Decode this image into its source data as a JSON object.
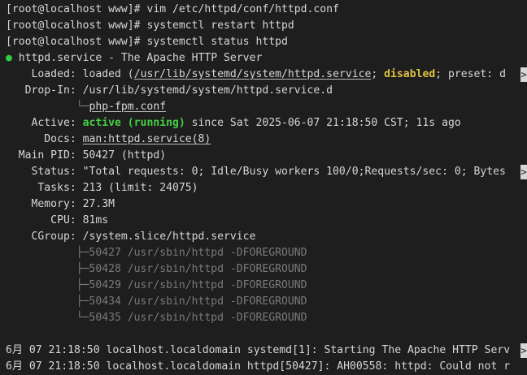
{
  "commands": [
    {
      "prompt": "[root@localhost www]# ",
      "cmd": "vim /etc/httpd/conf/httpd.conf"
    },
    {
      "prompt": "[root@localhost www]# ",
      "cmd": "systemctl restart httpd"
    },
    {
      "prompt": "[root@localhost www]# ",
      "cmd": "systemctl status httpd"
    }
  ],
  "status": {
    "dot": "●",
    "unit": " httpd.service - The Apache HTTP Server",
    "loaded": {
      "label": "    Loaded: ",
      "pre": "loaded (",
      "path": "/usr/lib/systemd/system/httpd.service",
      "sep": "; ",
      "state": "disabled",
      "post": "; preset: d"
    },
    "dropin": {
      "label": "   Drop-In: ",
      "value": "/usr/lib/systemd/system/httpd.service.d",
      "tree": "           └─",
      "file": "php-fpm.conf"
    },
    "active": {
      "label": "    Active: ",
      "state": "active (running)",
      "since": " since Sat 2025-06-07 21:18:50 CST; 11s ago"
    },
    "docs": {
      "label": "      Docs: ",
      "value": "man:httpd.service(8)"
    },
    "mainpid": {
      "label": "  Main PID: ",
      "value": "50427 (httpd)"
    },
    "statusline": {
      "label": "    Status: ",
      "value": "\"Total requests: 0; Idle/Busy workers 100/0;Requests/sec: 0; Bytes"
    },
    "tasks": {
      "label": "     Tasks: ",
      "value": "213 (limit: 24075)"
    },
    "memory": {
      "label": "    Memory: ",
      "value": "27.3M"
    },
    "cpu": {
      "label": "       CPU: ",
      "value": "81ms"
    },
    "cgroup": {
      "label": "    CGroup: ",
      "value": "/system.slice/httpd.service",
      "processes": [
        {
          "tree": "           ├─",
          "entry": "50427 /usr/sbin/httpd -DFOREGROUND"
        },
        {
          "tree": "           ├─",
          "entry": "50428 /usr/sbin/httpd -DFOREGROUND"
        },
        {
          "tree": "           ├─",
          "entry": "50429 /usr/sbin/httpd -DFOREGROUND"
        },
        {
          "tree": "           ├─",
          "entry": "50434 /usr/sbin/httpd -DFOREGROUND"
        },
        {
          "tree": "           └─",
          "entry": "50435 /usr/sbin/httpd -DFOREGROUND"
        }
      ]
    }
  },
  "log": [
    "6月 07 21:18:50 localhost.localdomain systemd[1]: Starting The Apache HTTP Serv",
    "6月 07 21:18:50 localhost.localdomain httpd[50427]: AH00558: httpd: Could not r"
  ],
  "truncation_marker": ">"
}
